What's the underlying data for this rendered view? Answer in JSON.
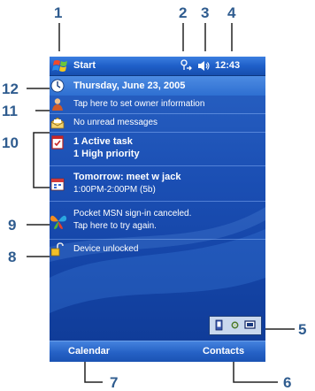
{
  "callouts": [
    "1",
    "2",
    "3",
    "4",
    "5",
    "6",
    "7",
    "8",
    "9",
    "10",
    "11",
    "12"
  ],
  "titlebar": {
    "start_label": "Start",
    "clock": "12:43",
    "icons": [
      "windows-start-icon",
      "connectivity-icon",
      "speaker-icon"
    ]
  },
  "today": {
    "date": "Thursday, June 23, 2005",
    "owner": "Tap here to set owner information",
    "messages": "No unread messages",
    "tasks": {
      "line1": "1 Active task",
      "line2": "1 High priority"
    },
    "calendar": {
      "line1": "Tomorrow: meet w jack",
      "line2": "1:00PM-2:00PM (5b)"
    },
    "msn": {
      "line1": "Pocket MSN sign-in canceled.",
      "line2": "Tap here to try again."
    },
    "device": "Device unlocked"
  },
  "softkeys": {
    "left": "Calendar",
    "right": "Contacts"
  },
  "colors": {
    "accent": "#2f5c8f",
    "screen": "#1b4fb4"
  }
}
